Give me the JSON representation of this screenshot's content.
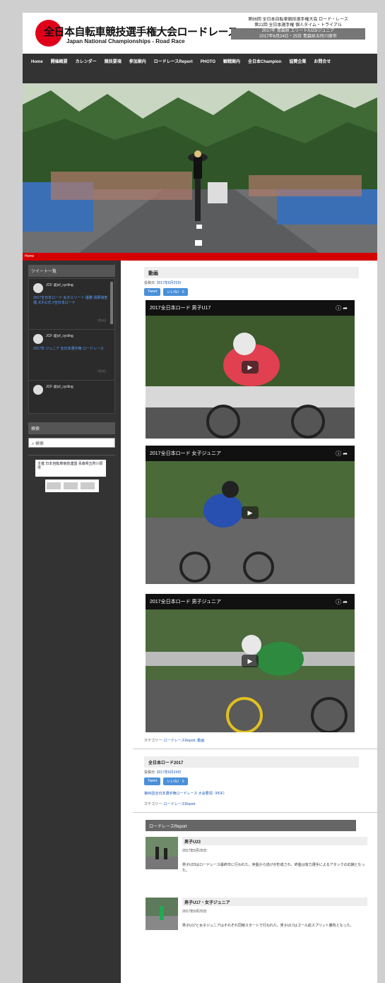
{
  "header": {
    "title": "全日本自転車競技選手権大会ロードレース",
    "subtitle": "Japan National Championships - Road Race",
    "event_lines": [
      "第86回 全日本自転車競技選手権大会 ロード・レース",
      "第21回 全日本選手権 個人タイム・トライアル",
      "2017年 青森県 エリート/U23/ジュニア",
      "2017年6月24日・25日 青森県五所川原市"
    ]
  },
  "nav": {
    "items": [
      "Home",
      "開催概要",
      "カレンダー",
      "競技要項",
      "参加案内",
      "ロードレースReport",
      "PHOTO",
      "観戦案内",
      "全日本Champion",
      "協賛企業",
      "お問合せ"
    ]
  },
  "redbar": {
    "label": "Home"
  },
  "sidebar": {
    "twitter_title": "ツイート一覧",
    "tweets": [
      {
        "name": "JCF @jcf_cycling",
        "text": "2017全日本ロード 女子エリート 優勝 與那嶺恵理 JCF公式 #全日本ロード",
        "time": "7月2日"
      },
      {
        "name": "JCF @jcf_cycling",
        "text": "2017年 ジュニア 全日本選手権 ロードレース",
        "time": "7月2日"
      },
      {
        "name": "JCF @jcf_cycling",
        "text": "",
        "time": ""
      }
    ],
    "search_title": "検索",
    "search_placeholder": "検索",
    "sponsor_text": "主催 日本自転車競技連盟 青森県五所川原市"
  },
  "main": {
    "post_title": "動画",
    "post_meta_label": "投稿日:",
    "post_meta_link": "2017年6月25日",
    "share_buttons": [
      "Tweet",
      "いいね！ 0"
    ],
    "videos": [
      {
        "title": "2017全日本ロード 男子U17"
      },
      {
        "title": "2017全日本ロード 女子ジュニア"
      },
      {
        "title": "2017全日本ロード 男子ジュニア"
      }
    ],
    "tags_label": "カテゴリー:",
    "tags_link": "ロードレースReport, 動画",
    "post2_title": "全日本ロード2017",
    "post2_meta_label": "投稿日:",
    "post2_meta_link": "2017年6月24日",
    "post2_share": [
      "Tweet",
      "いいね！ 0"
    ],
    "post2_link": "第86回全日本選手権ロードレース 大会要項（PDF）",
    "post2_tags_label": "カテゴリー:",
    "post2_tags_link": "ロードレースReport",
    "report_title": "ロードレースReport",
    "reports": [
      {
        "heading": "男子U23",
        "date": "2017年6月25日",
        "text": "男子U23はロードレース最終日に行われた。序盤から逃げが形成され、終盤は有力選手によるアタックの応酬となった。"
      },
      {
        "heading": "男子U17・女子ジュニア",
        "date": "2017年6月25日",
        "text": "男子U17と女子ジュニアはそれぞれ同時スタートで行われた。男子U17はゴール前スプリント勝負となった。"
      }
    ]
  },
  "colors": {
    "accent": "#d40000",
    "nav_bg": "#333333",
    "link": "#1a57b5"
  }
}
